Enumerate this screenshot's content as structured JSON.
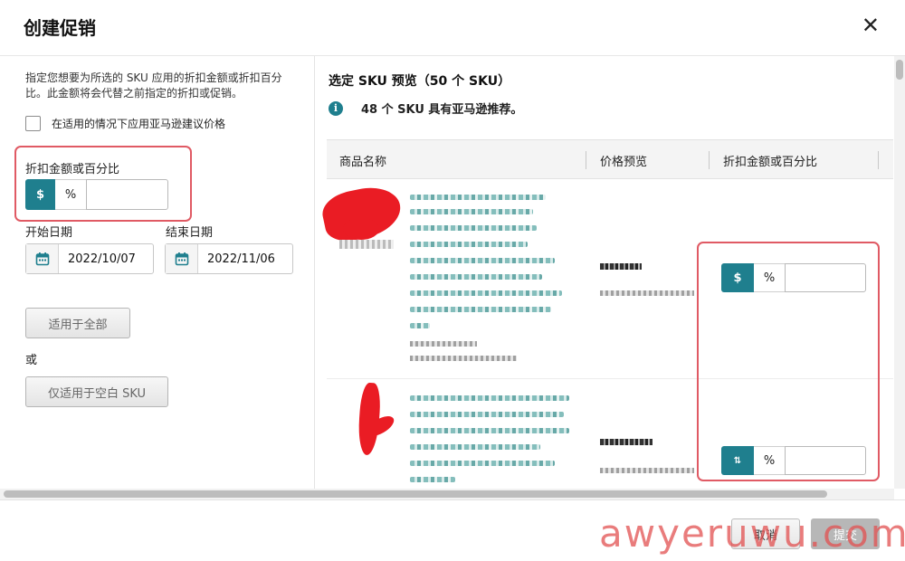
{
  "dialog": {
    "title": "创建促销",
    "close_glyph": "✕"
  },
  "left": {
    "description": "指定您想要为所选的 SKU 应用的折扣金额或折扣百分比。此金额将会代替之前指定的折扣或促销。",
    "checkbox_label": "在适用的情况下应用亚马逊建议价格",
    "discount_label": "折扣金额或百分比",
    "dollar": "$",
    "percent": "%",
    "start_label": "开始日期",
    "start_date": "2022/10/07",
    "end_label": "结束日期",
    "end_date": "2022/11/06",
    "apply_all": "适用于全部",
    "or": "或",
    "apply_blank": "仅适用于空白 SKU"
  },
  "right": {
    "preview_title": "选定 SKU 预览（50 个 SKU）",
    "info_glyph": "i",
    "info_text": "48 个 SKU 具有亚马逊推荐。",
    "columns": [
      "商品名称",
      "价格预览",
      "折扣金额或百分比"
    ],
    "row_dollar": "$",
    "row_percent": "%"
  },
  "footer": {
    "cancel": "取消",
    "submit": "提交",
    "watermark": "awyeruwu.com"
  },
  "colors": {
    "accent": "#1f7f8e",
    "highlight": "#e05a64",
    "redaction": "#ea1c24"
  }
}
